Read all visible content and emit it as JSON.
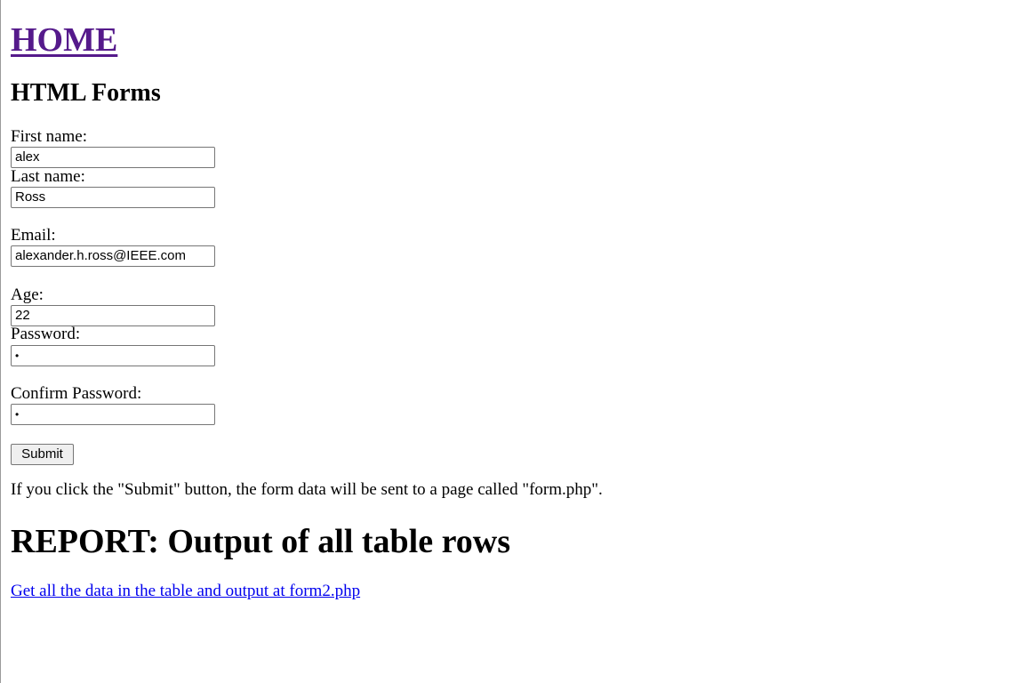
{
  "nav": {
    "home_label": "HOME"
  },
  "form": {
    "heading": "HTML Forms",
    "fields": {
      "first_name": {
        "label": "First name:",
        "value": "alex"
      },
      "last_name": {
        "label": "Last name:",
        "value": "Ross"
      },
      "email": {
        "label": "Email:",
        "value": "alexander.h.ross@IEEE.com"
      },
      "age": {
        "label": "Age:",
        "value": "22"
      },
      "password": {
        "label": "Password:",
        "value": "•"
      },
      "confirm_password": {
        "label": "Confirm Password:",
        "value": "•"
      }
    },
    "submit_label": "Submit",
    "info_text": "If you click the \"Submit\" button, the form data will be sent to a page called \"form.php\"."
  },
  "report": {
    "heading": "REPORT: Output of all table rows",
    "link_text": "Get all the data in the table and output at form2.php"
  },
  "colors": {
    "visited_link": "#551a8b",
    "link": "#0000ee",
    "input_border": "#767676",
    "button_bg": "#efefef"
  }
}
